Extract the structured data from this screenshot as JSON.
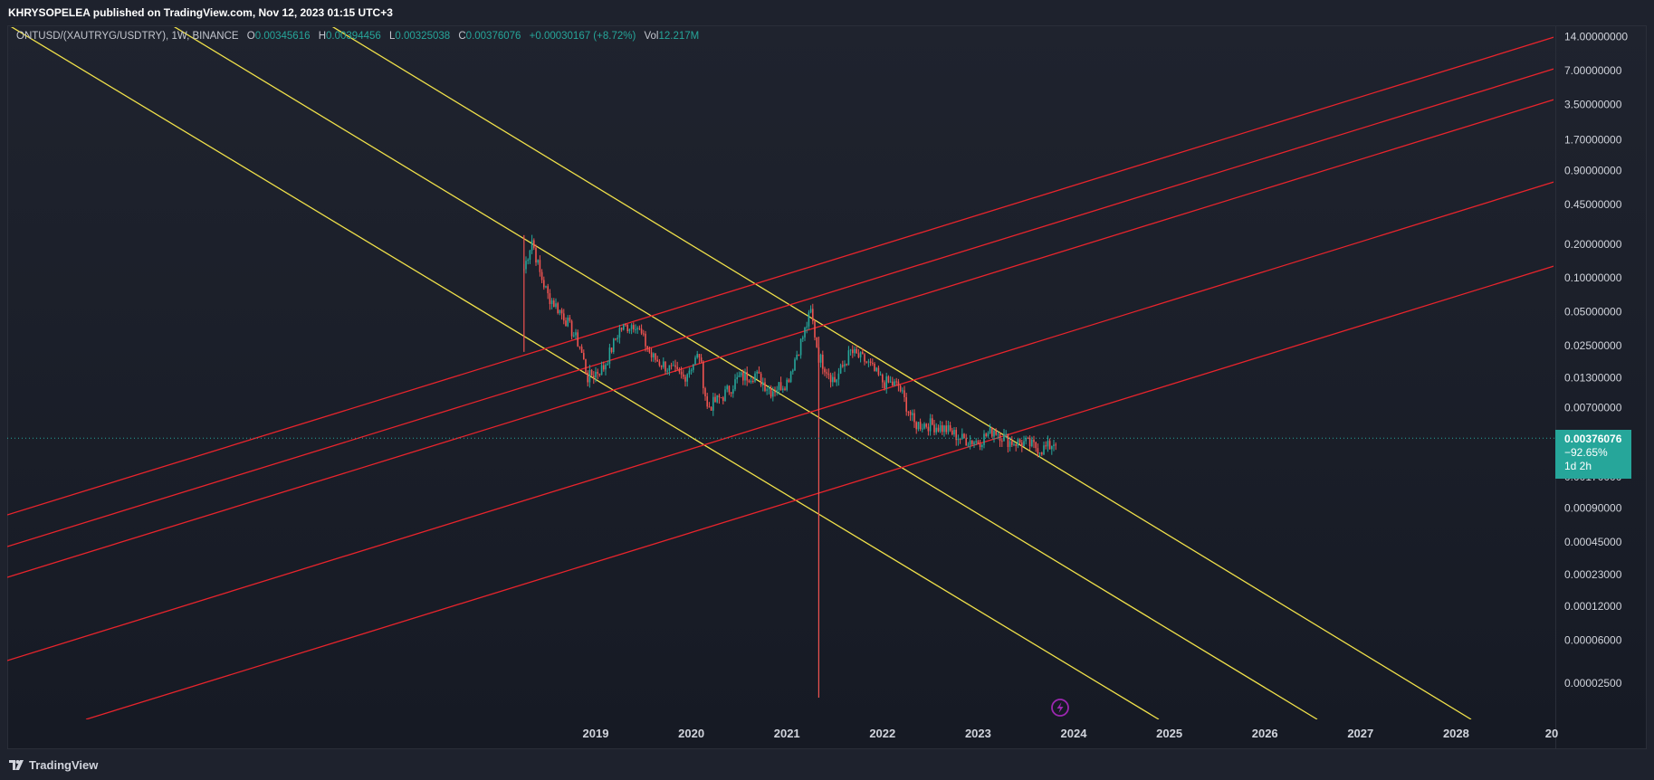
{
  "header": {
    "publisher": "KHRYSOPELEA published on TradingView.com, Nov 12, 2023 01:15 UTC+3"
  },
  "legend": {
    "symbol": "ONTUSD/(XAUTRYG/USDTRY), 1W, BINANCE",
    "open_label": "O",
    "open": "0.00345616",
    "high_label": "H",
    "high": "0.00394456",
    "low_label": "L",
    "low": "0.00325038",
    "close_label": "C",
    "close": "0.00376076",
    "change": "+0.00030167 (+8.72%)",
    "vol_label": "Vol",
    "vol": "12.217M"
  },
  "price_badge": {
    "price": "0.00376076",
    "change_pct": "−92.65%",
    "countdown": "1d 2h"
  },
  "footer": {
    "brand": "TradingView"
  },
  "colors": {
    "up": "#26a69a",
    "down": "#ef5350",
    "channel_yellow": "#f0e14a",
    "channel_red": "#e8242c"
  },
  "chart_data": {
    "type": "candlestick",
    "scale": "log",
    "ylim": [
      1.85e-05,
      17
    ],
    "y_ticks": [
      "14.00000000",
      "7.00000000",
      "3.50000000",
      "1.70000000",
      "0.90000000",
      "0.45000000",
      "0.20000000",
      "0.10000000",
      "0.05000000",
      "0.02500000",
      "0.01300000",
      "0.00700000",
      "0.00170000",
      "0.00090000",
      "0.00045000",
      "0.00023000",
      "0.00012000",
      "0.00006000",
      "0.00002500"
    ],
    "x_ticks": [
      "2019",
      "2020",
      "2021",
      "2022",
      "2023",
      "2024",
      "2025",
      "2026",
      "2027",
      "2028",
      "20"
    ],
    "last_price": 0.00376076,
    "series_path": [
      {
        "t": "2018-04",
        "v": 0.12
      },
      {
        "t": "2018-05",
        "v": 0.22
      },
      {
        "t": "2018-06",
        "v": 0.11
      },
      {
        "t": "2018-07",
        "v": 0.07
      },
      {
        "t": "2018-09",
        "v": 0.046
      },
      {
        "t": "2018-11",
        "v": 0.025
      },
      {
        "t": "2018-12",
        "v": 0.013
      },
      {
        "t": "2019-02",
        "v": 0.016
      },
      {
        "t": "2019-04",
        "v": 0.035
      },
      {
        "t": "2019-06",
        "v": 0.04
      },
      {
        "t": "2019-08",
        "v": 0.02
      },
      {
        "t": "2019-10",
        "v": 0.016
      },
      {
        "t": "2019-12",
        "v": 0.013
      },
      {
        "t": "2020-02",
        "v": 0.021
      },
      {
        "t": "2020-03",
        "v": 0.007
      },
      {
        "t": "2020-05",
        "v": 0.009
      },
      {
        "t": "2020-07",
        "v": 0.013
      },
      {
        "t": "2020-09",
        "v": 0.014
      },
      {
        "t": "2020-11",
        "v": 0.01
      },
      {
        "t": "2021-01",
        "v": 0.012
      },
      {
        "t": "2021-03",
        "v": 0.03
      },
      {
        "t": "2021-04",
        "v": 0.05
      },
      {
        "t": "2021-05",
        "v": 0.02
      },
      {
        "t": "2021-07",
        "v": 0.012
      },
      {
        "t": "2021-09",
        "v": 0.022
      },
      {
        "t": "2021-11",
        "v": 0.018
      },
      {
        "t": "2022-01",
        "v": 0.012
      },
      {
        "t": "2022-03",
        "v": 0.011
      },
      {
        "t": "2022-05",
        "v": 0.005
      },
      {
        "t": "2022-07",
        "v": 0.005
      },
      {
        "t": "2022-09",
        "v": 0.0045
      },
      {
        "t": "2022-11",
        "v": 0.0037
      },
      {
        "t": "2023-01",
        "v": 0.0035
      },
      {
        "t": "2023-03",
        "v": 0.0045
      },
      {
        "t": "2023-05",
        "v": 0.0035
      },
      {
        "t": "2023-07",
        "v": 0.0034
      },
      {
        "t": "2023-09",
        "v": 0.003
      },
      {
        "t": "2023-10",
        "v": 0.0032
      },
      {
        "t": "2023-11",
        "v": 0.00376
      }
    ]
  }
}
